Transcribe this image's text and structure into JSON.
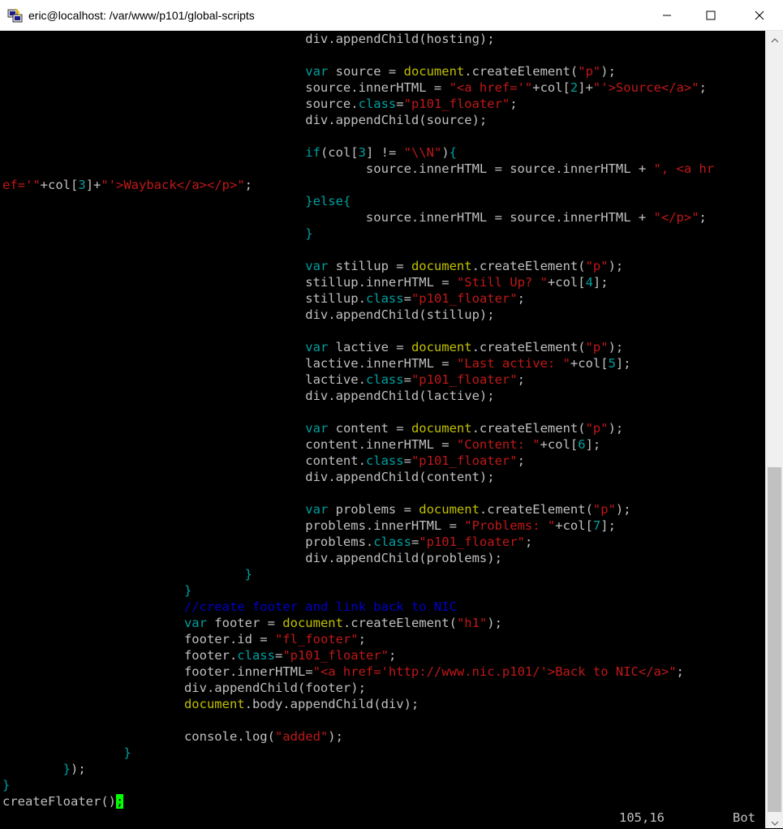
{
  "window": {
    "title": "eric@localhost: /var/www/p101/global-scripts",
    "icons": {
      "app": "putty-icon",
      "minimize": "minimize-icon",
      "maximize": "maximize-icon",
      "close": "close-icon"
    }
  },
  "colors": {
    "background": "#000000",
    "text": "#c0c0c0",
    "keyword": "#00a0a0",
    "string": "#c01818",
    "function": "#c0c000",
    "comment": "#0000c8",
    "cursor": "#00ff00"
  },
  "editor": {
    "lines": [
      [
        {
          "t": "t",
          "v": "                                        div.appendChild(hosting);"
        }
      ],
      [],
      [
        {
          "t": "t",
          "v": "                                        "
        },
        {
          "t": "k",
          "v": "var"
        },
        {
          "t": "t",
          "v": " source = "
        },
        {
          "t": "f",
          "v": "document"
        },
        {
          "t": "t",
          "v": ".createElement("
        },
        {
          "t": "s",
          "v": "\"p\""
        },
        {
          "t": "t",
          "v": ");"
        }
      ],
      [
        {
          "t": "t",
          "v": "                                        source.innerHTML = "
        },
        {
          "t": "s",
          "v": "\"<a href='\""
        },
        {
          "t": "t",
          "v": "+col["
        },
        {
          "t": "p",
          "v": "2"
        },
        {
          "t": "t",
          "v": "]+"
        },
        {
          "t": "s",
          "v": "\"'>Source</a>\""
        },
        {
          "t": "t",
          "v": ";"
        }
      ],
      [
        {
          "t": "t",
          "v": "                                        source."
        },
        {
          "t": "k",
          "v": "class"
        },
        {
          "t": "t",
          "v": "="
        },
        {
          "t": "s",
          "v": "\"p101_floater\""
        },
        {
          "t": "t",
          "v": ";"
        }
      ],
      [
        {
          "t": "t",
          "v": "                                        div.appendChild(source);"
        }
      ],
      [],
      [
        {
          "t": "t",
          "v": "                                        "
        },
        {
          "t": "k",
          "v": "if"
        },
        {
          "t": "t",
          "v": "(col["
        },
        {
          "t": "p",
          "v": "3"
        },
        {
          "t": "t",
          "v": "] != "
        },
        {
          "t": "s",
          "v": "\"\\\\N\""
        },
        {
          "t": "t",
          "v": ")"
        },
        {
          "t": "p",
          "v": "{"
        }
      ],
      [
        {
          "t": "t",
          "v": "                                                source.innerHTML = source.innerHTML + "
        },
        {
          "t": "s",
          "v": "\", <a hr"
        }
      ],
      [
        {
          "t": "s",
          "v": "ef='\""
        },
        {
          "t": "t",
          "v": "+col["
        },
        {
          "t": "p",
          "v": "3"
        },
        {
          "t": "t",
          "v": "]+"
        },
        {
          "t": "s",
          "v": "\"'>Wayback</a></p>\""
        },
        {
          "t": "t",
          "v": ";"
        }
      ],
      [
        {
          "t": "t",
          "v": "                                        "
        },
        {
          "t": "p",
          "v": "}"
        },
        {
          "t": "k",
          "v": "else"
        },
        {
          "t": "p",
          "v": "{"
        }
      ],
      [
        {
          "t": "t",
          "v": "                                                source.innerHTML = source.innerHTML + "
        },
        {
          "t": "s",
          "v": "\"</p>\""
        },
        {
          "t": "t",
          "v": ";"
        }
      ],
      [
        {
          "t": "t",
          "v": "                                        "
        },
        {
          "t": "p",
          "v": "}"
        }
      ],
      [],
      [
        {
          "t": "t",
          "v": "                                        "
        },
        {
          "t": "k",
          "v": "var"
        },
        {
          "t": "t",
          "v": " stillup = "
        },
        {
          "t": "f",
          "v": "document"
        },
        {
          "t": "t",
          "v": ".createElement("
        },
        {
          "t": "s",
          "v": "\"p\""
        },
        {
          "t": "t",
          "v": ");"
        }
      ],
      [
        {
          "t": "t",
          "v": "                                        stillup.innerHTML = "
        },
        {
          "t": "s",
          "v": "\"Still Up? \""
        },
        {
          "t": "t",
          "v": "+col["
        },
        {
          "t": "p",
          "v": "4"
        },
        {
          "t": "t",
          "v": "];"
        }
      ],
      [
        {
          "t": "t",
          "v": "                                        stillup."
        },
        {
          "t": "k",
          "v": "class"
        },
        {
          "t": "t",
          "v": "="
        },
        {
          "t": "s",
          "v": "\"p101_floater\""
        },
        {
          "t": "t",
          "v": ";"
        }
      ],
      [
        {
          "t": "t",
          "v": "                                        div.appendChild(stillup);"
        }
      ],
      [],
      [
        {
          "t": "t",
          "v": "                                        "
        },
        {
          "t": "k",
          "v": "var"
        },
        {
          "t": "t",
          "v": " lactive = "
        },
        {
          "t": "f",
          "v": "document"
        },
        {
          "t": "t",
          "v": ".createElement("
        },
        {
          "t": "s",
          "v": "\"p\""
        },
        {
          "t": "t",
          "v": ");"
        }
      ],
      [
        {
          "t": "t",
          "v": "                                        lactive.innerHTML = "
        },
        {
          "t": "s",
          "v": "\"Last active: \""
        },
        {
          "t": "t",
          "v": "+col["
        },
        {
          "t": "p",
          "v": "5"
        },
        {
          "t": "t",
          "v": "];"
        }
      ],
      [
        {
          "t": "t",
          "v": "                                        lactive."
        },
        {
          "t": "k",
          "v": "class"
        },
        {
          "t": "t",
          "v": "="
        },
        {
          "t": "s",
          "v": "\"p101_floater\""
        },
        {
          "t": "t",
          "v": ";"
        }
      ],
      [
        {
          "t": "t",
          "v": "                                        div.appendChild(lactive);"
        }
      ],
      [],
      [
        {
          "t": "t",
          "v": "                                        "
        },
        {
          "t": "k",
          "v": "var"
        },
        {
          "t": "t",
          "v": " content = "
        },
        {
          "t": "f",
          "v": "document"
        },
        {
          "t": "t",
          "v": ".createElement("
        },
        {
          "t": "s",
          "v": "\"p\""
        },
        {
          "t": "t",
          "v": ");"
        }
      ],
      [
        {
          "t": "t",
          "v": "                                        content.innerHTML = "
        },
        {
          "t": "s",
          "v": "\"Content: \""
        },
        {
          "t": "t",
          "v": "+col["
        },
        {
          "t": "p",
          "v": "6"
        },
        {
          "t": "t",
          "v": "];"
        }
      ],
      [
        {
          "t": "t",
          "v": "                                        content."
        },
        {
          "t": "k",
          "v": "class"
        },
        {
          "t": "t",
          "v": "="
        },
        {
          "t": "s",
          "v": "\"p101_floater\""
        },
        {
          "t": "t",
          "v": ";"
        }
      ],
      [
        {
          "t": "t",
          "v": "                                        div.appendChild(content);"
        }
      ],
      [],
      [
        {
          "t": "t",
          "v": "                                        "
        },
        {
          "t": "k",
          "v": "var"
        },
        {
          "t": "t",
          "v": " problems = "
        },
        {
          "t": "f",
          "v": "document"
        },
        {
          "t": "t",
          "v": ".createElement("
        },
        {
          "t": "s",
          "v": "\"p\""
        },
        {
          "t": "t",
          "v": ");"
        }
      ],
      [
        {
          "t": "t",
          "v": "                                        problems.innerHTML = "
        },
        {
          "t": "s",
          "v": "\"Problems: \""
        },
        {
          "t": "t",
          "v": "+col["
        },
        {
          "t": "p",
          "v": "7"
        },
        {
          "t": "t",
          "v": "];"
        }
      ],
      [
        {
          "t": "t",
          "v": "                                        problems."
        },
        {
          "t": "k",
          "v": "class"
        },
        {
          "t": "t",
          "v": "="
        },
        {
          "t": "s",
          "v": "\"p101_floater\""
        },
        {
          "t": "t",
          "v": ";"
        }
      ],
      [
        {
          "t": "t",
          "v": "                                        div.appendChild(problems);"
        }
      ],
      [
        {
          "t": "t",
          "v": "                                "
        },
        {
          "t": "p",
          "v": "}"
        }
      ],
      [
        {
          "t": "t",
          "v": "                        "
        },
        {
          "t": "p",
          "v": "}"
        }
      ],
      [
        {
          "t": "t",
          "v": "                        "
        },
        {
          "t": "c",
          "v": "//create footer and link back to NIC"
        }
      ],
      [
        {
          "t": "t",
          "v": "                        "
        },
        {
          "t": "k",
          "v": "var"
        },
        {
          "t": "t",
          "v": " footer = "
        },
        {
          "t": "f",
          "v": "document"
        },
        {
          "t": "t",
          "v": ".createElement("
        },
        {
          "t": "s",
          "v": "\"h1\""
        },
        {
          "t": "t",
          "v": ");"
        }
      ],
      [
        {
          "t": "t",
          "v": "                        footer.id = "
        },
        {
          "t": "s",
          "v": "\"fl_footer\""
        },
        {
          "t": "t",
          "v": ";"
        }
      ],
      [
        {
          "t": "t",
          "v": "                        footer."
        },
        {
          "t": "k",
          "v": "class"
        },
        {
          "t": "t",
          "v": "="
        },
        {
          "t": "s",
          "v": "\"p101_floater\""
        },
        {
          "t": "t",
          "v": ";"
        }
      ],
      [
        {
          "t": "t",
          "v": "                        footer.innerHTML="
        },
        {
          "t": "s",
          "v": "\"<a href='http://www.nic.p101/'>Back to NIC</a>\""
        },
        {
          "t": "t",
          "v": ";"
        }
      ],
      [
        {
          "t": "t",
          "v": "                        div.appendChild(footer);"
        }
      ],
      [
        {
          "t": "t",
          "v": "                        "
        },
        {
          "t": "f",
          "v": "document"
        },
        {
          "t": "t",
          "v": ".body.appendChild(div);"
        }
      ],
      [],
      [
        {
          "t": "t",
          "v": "                        console.log("
        },
        {
          "t": "s",
          "v": "\"added\""
        },
        {
          "t": "t",
          "v": ");"
        }
      ],
      [
        {
          "t": "t",
          "v": "                "
        },
        {
          "t": "p",
          "v": "}"
        }
      ],
      [
        {
          "t": "t",
          "v": "        "
        },
        {
          "t": "p",
          "v": "}"
        },
        {
          "t": "t",
          "v": ");"
        }
      ],
      [
        {
          "t": "p",
          "v": "}"
        }
      ],
      [
        {
          "t": "t",
          "v": "createFloater()"
        },
        {
          "t": "cur",
          "v": ";"
        }
      ]
    ]
  },
  "status": {
    "position": "105,16",
    "scroll": "Bot"
  }
}
